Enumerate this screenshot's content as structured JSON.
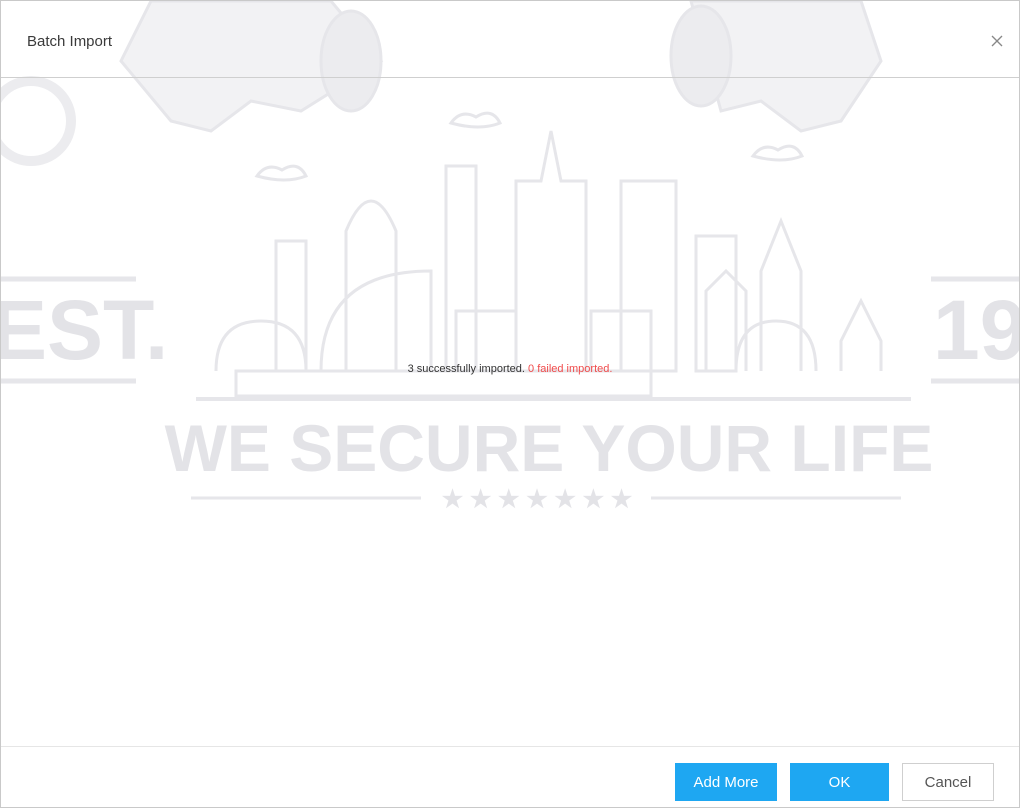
{
  "dialog": {
    "title": "Batch Import",
    "close_icon": "close-icon"
  },
  "watermark": {
    "left_text": "EST.",
    "right_text": "19",
    "tagline": "WE SECURE YOUR LIFE",
    "stars": "★ ★ ★ ★ ★ ★ ★",
    "color": "#e3e3e7"
  },
  "result": {
    "success_text": "3 successfully imported.",
    "failed_text": "0 failed imported.",
    "failed_color": "#f04b4b"
  },
  "footer": {
    "add_more_label": "Add More",
    "ok_label": "OK",
    "cancel_label": "Cancel",
    "primary_color": "#1ea7f2"
  }
}
